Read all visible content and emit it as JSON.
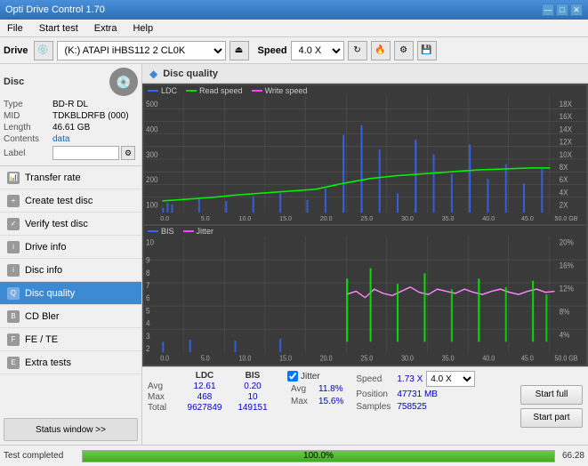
{
  "app": {
    "title": "Opti Drive Control 1.70",
    "title_bar_buttons": [
      "—",
      "□",
      "✕"
    ]
  },
  "menu": {
    "items": [
      "File",
      "Start test",
      "Extra",
      "Help"
    ]
  },
  "toolbar": {
    "drive_label": "Drive",
    "drive_value": "(K:)  ATAPI iHBS112  2 CL0K",
    "speed_label": "Speed",
    "speed_value": "4.0 X"
  },
  "disc": {
    "title": "Disc",
    "type_label": "Type",
    "type_value": "BD-R DL",
    "mid_label": "MID",
    "mid_value": "TDKBLDRFB (000)",
    "length_label": "Length",
    "length_value": "46.61 GB",
    "contents_label": "Contents",
    "contents_value": "data",
    "label_label": "Label",
    "label_value": ""
  },
  "nav": {
    "items": [
      {
        "id": "transfer-rate",
        "label": "Transfer rate",
        "active": false
      },
      {
        "id": "create-test-disc",
        "label": "Create test disc",
        "active": false
      },
      {
        "id": "verify-test-disc",
        "label": "Verify test disc",
        "active": false
      },
      {
        "id": "drive-info",
        "label": "Drive info",
        "active": false
      },
      {
        "id": "disc-info",
        "label": "Disc info",
        "active": false
      },
      {
        "id": "disc-quality",
        "label": "Disc quality",
        "active": true
      },
      {
        "id": "cd-bler",
        "label": "CD Bler",
        "active": false
      },
      {
        "id": "fe-te",
        "label": "FE / TE",
        "active": false
      },
      {
        "id": "extra-tests",
        "label": "Extra tests",
        "active": false
      }
    ],
    "status_btn": "Status window >>"
  },
  "quality": {
    "title": "Disc quality",
    "chart1": {
      "legend": [
        {
          "color": "#3366ff",
          "label": "LDC"
        },
        {
          "color": "#00dd00",
          "label": "Read speed"
        },
        {
          "color": "#ff44ff",
          "label": "Write speed"
        }
      ],
      "y_max": 500,
      "y_right_labels": [
        "18X",
        "16X",
        "14X",
        "12X",
        "10X",
        "8X",
        "6X",
        "4X",
        "2X"
      ],
      "x_labels": [
        "0.0",
        "5.0",
        "10.0",
        "15.0",
        "20.0",
        "25.0",
        "30.0",
        "35.0",
        "40.0",
        "45.0",
        "50.0 GB"
      ]
    },
    "chart2": {
      "legend": [
        {
          "color": "#3366ff",
          "label": "BIS"
        },
        {
          "color": "#ff44ff",
          "label": "Jitter"
        }
      ],
      "y_max": 10,
      "y_right_labels": [
        "20%",
        "16%",
        "12%",
        "8%",
        "4%"
      ],
      "x_labels": [
        "0.0",
        "5.0",
        "10.0",
        "15.0",
        "20.0",
        "25.0",
        "30.0",
        "35.0",
        "40.0",
        "45.0",
        "50.0 GB"
      ]
    }
  },
  "stats": {
    "headers": [
      "",
      "LDC",
      "BIS"
    ],
    "avg_label": "Avg",
    "avg_ldc": "12.61",
    "avg_bis": "0.20",
    "max_label": "Max",
    "max_ldc": "468",
    "max_bis": "10",
    "total_label": "Total",
    "total_ldc": "9627849",
    "total_bis": "149151",
    "jitter_checked": true,
    "jitter_label": "Jitter",
    "jitter_avg": "11.8%",
    "jitter_max": "15.6%",
    "speed_label": "Speed",
    "speed_val": "1.73 X",
    "speed_select": "4.0 X",
    "position_label": "Position",
    "position_val": "47731 MB",
    "samples_label": "Samples",
    "samples_val": "758525",
    "btn_start_full": "Start full",
    "btn_start_part": "Start part"
  },
  "statusbar": {
    "text": "Test completed",
    "progress": 100,
    "progress_label": "100.0%",
    "right_val": "66.28"
  }
}
